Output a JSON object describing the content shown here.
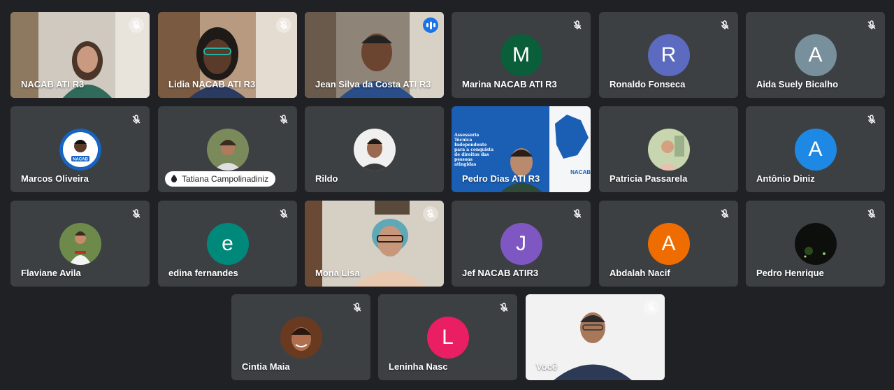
{
  "participants": [
    {
      "name": "NACAB ATI R3",
      "type": "video"
    },
    {
      "name": "Lidia NACAB ATI R3",
      "type": "video"
    },
    {
      "name": "Jean Silva da Costa ATI R3",
      "type": "video",
      "speaking": true
    },
    {
      "name": "Marina NACAB ATI R3",
      "type": "letter",
      "initial": "M",
      "color": "#0b5e3a"
    },
    {
      "name": "Ronaldo Fonseca",
      "type": "letter",
      "initial": "R",
      "color": "#5c6bc0"
    },
    {
      "name": "Aida Suely Bicalho",
      "type": "letter",
      "initial": "A",
      "color": "#78909c"
    },
    {
      "name": "Marcos Oliveira",
      "type": "photo",
      "avatar_label": "NACAB"
    },
    {
      "name": "Tatiana Campolinadiniz",
      "type": "photo",
      "pinned_pill": true
    },
    {
      "name": "Rildo",
      "type": "photo"
    },
    {
      "name": "Pedro Dias ATI R3",
      "type": "video",
      "slide_text": "Assessoria Técnica Independente para a conquista de direitos das pessoas atingidas",
      "slide_logo": "NACAB"
    },
    {
      "name": "Patricia Passarela",
      "type": "photo"
    },
    {
      "name": "Antônio Diniz",
      "type": "letter",
      "initial": "A",
      "color": "#1e88e5"
    },
    {
      "name": "Flaviane Avila",
      "type": "photo"
    },
    {
      "name": "edina fernandes",
      "type": "letter",
      "initial": "e",
      "color": "#00897b"
    },
    {
      "name": "Mona Lisa",
      "type": "video"
    },
    {
      "name": "Jef NACAB ATIR3",
      "type": "letter",
      "initial": "J",
      "color": "#7e57c2"
    },
    {
      "name": "Abdalah Nacif",
      "type": "letter",
      "initial": "A",
      "color": "#ef6c00"
    },
    {
      "name": "Pedro Henrique",
      "type": "photo"
    },
    {
      "name": "Cintia Maia",
      "type": "photo"
    },
    {
      "name": "Leninha Nasc",
      "type": "letter",
      "initial": "L",
      "color": "#e91e63"
    },
    {
      "name": "Você",
      "type": "video",
      "self": true
    }
  ],
  "icons": {
    "muted": "mic-off-icon",
    "speaking": "audio-level-icon",
    "pin": "pin-icon"
  },
  "colors": {
    "background": "#202124",
    "tile": "#3c4043",
    "speaking_outline": "#8ab4f8"
  }
}
